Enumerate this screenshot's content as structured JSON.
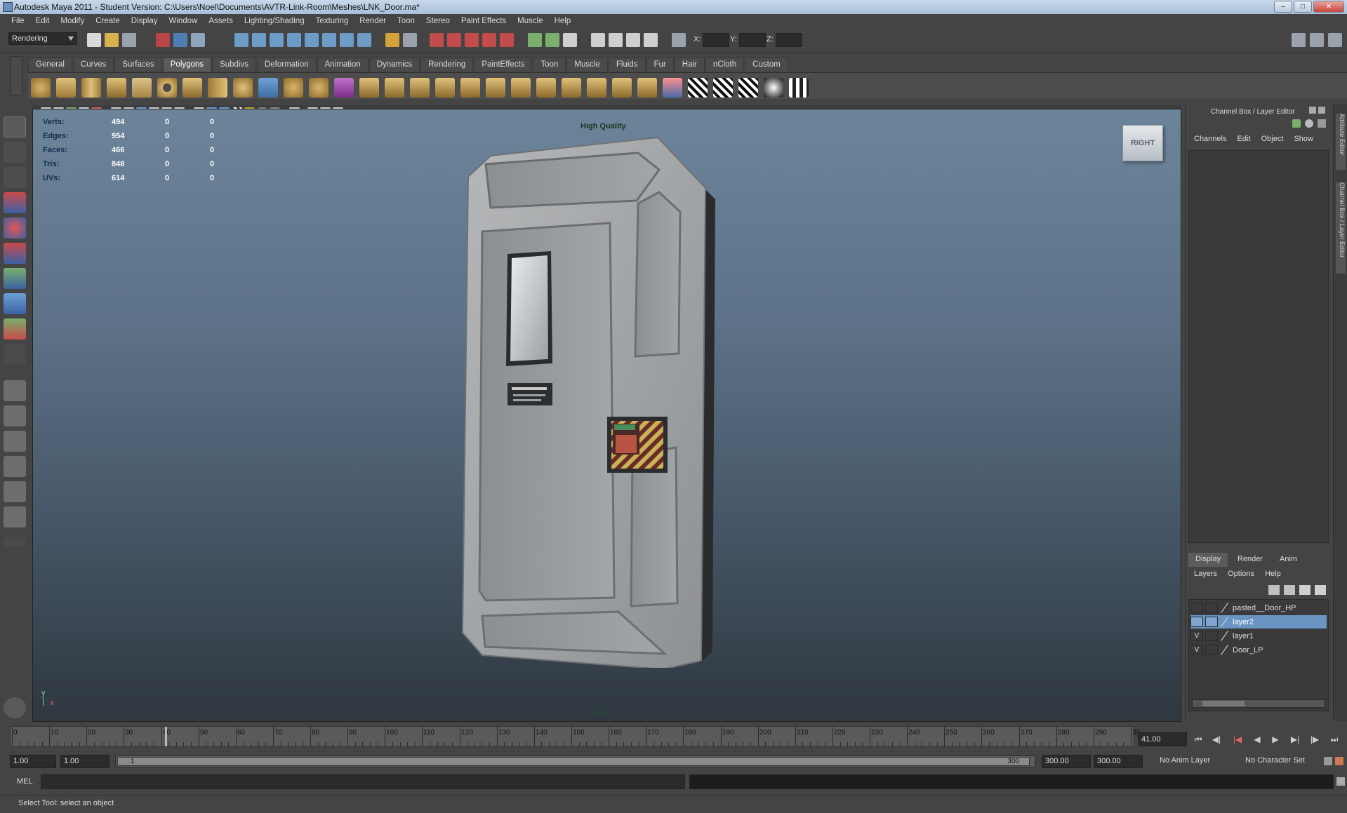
{
  "window": {
    "title": "Autodesk Maya 2011 - Student Version: C:\\Users\\Noel\\Documents\\AVTR-Link-Room\\Meshes\\LNK_Door.ma*"
  },
  "menubar": [
    "File",
    "Edit",
    "Modify",
    "Create",
    "Display",
    "Window",
    "Assets",
    "Lighting/Shading",
    "Texturing",
    "Render",
    "Toon",
    "Stereo",
    "Paint Effects",
    "Muscle",
    "Help"
  ],
  "statusline": {
    "menuset": "Rendering",
    "x_label": "X:",
    "y_label": "Y:",
    "z_label": "Z:"
  },
  "shelf": {
    "tabs": [
      "General",
      "Curves",
      "Surfaces",
      "Polygons",
      "Subdivs",
      "Deformation",
      "Animation",
      "Dynamics",
      "Rendering",
      "PaintEffects",
      "Toon",
      "Muscle",
      "Fluids",
      "Fur",
      "Hair",
      "nCloth",
      "Custom"
    ],
    "active_tab": "Polygons"
  },
  "viewport": {
    "hud": {
      "rows": [
        {
          "label": "Verts:",
          "values": [
            "494",
            "0",
            "0"
          ]
        },
        {
          "label": "Edges:",
          "values": [
            "954",
            "0",
            "0"
          ]
        },
        {
          "label": "Faces:",
          "values": [
            "466",
            "0",
            "0"
          ]
        },
        {
          "label": "Tris:",
          "values": [
            "848",
            "0",
            "0"
          ]
        },
        {
          "label": "UVs:",
          "values": [
            "614",
            "0",
            "0"
          ]
        }
      ],
      "quality": "High Quality"
    },
    "viewcube_label": "RIGHT",
    "camera": "persp",
    "axis": {
      "y": "y",
      "x": "x"
    }
  },
  "channelbox": {
    "title": "Channel Box / Layer Editor",
    "menu": [
      "Channels",
      "Edit",
      "Object",
      "Show"
    ],
    "side_tabs": [
      "Attribute Editor",
      "Channel Box / Layer Editor"
    ]
  },
  "layer_editor": {
    "tabs": [
      "Display",
      "Render",
      "Anim"
    ],
    "active_tab": "Display",
    "menu": [
      "Layers",
      "Options",
      "Help"
    ],
    "layers": [
      {
        "name": "pasted__Door_HP",
        "visible": "",
        "selected": false
      },
      {
        "name": "layer2",
        "visible": "",
        "selected": true
      },
      {
        "name": "layer1",
        "visible": "V",
        "selected": false
      },
      {
        "name": "Door_LP",
        "visible": "V",
        "selected": false
      }
    ]
  },
  "timeline": {
    "ticks": [
      "0",
      "10",
      "20",
      "30",
      "40",
      "50",
      "60",
      "70",
      "80",
      "90",
      "100",
      "110",
      "120",
      "130",
      "140",
      "150",
      "160",
      "170",
      "180",
      "190",
      "200",
      "210",
      "220",
      "230",
      "240",
      "250",
      "260",
      "270",
      "280",
      "290",
      "30"
    ],
    "current_frame": "41.00",
    "range_start": "1.00",
    "playback_start": "1.00",
    "range_thumb_start": "1",
    "range_thumb_end": "300",
    "playback_end": "300.00",
    "range_end": "300.00",
    "anim_layer": "No Anim Layer",
    "character_set": "No Character Set"
  },
  "commandline": {
    "label": "MEL"
  },
  "helpline": {
    "text": "Select Tool: select an object"
  },
  "colors": {
    "ui_bg": "#444444",
    "viewport_top": "#6c849a",
    "viewport_bottom": "#2f373f",
    "selection": "#6a95c2"
  }
}
